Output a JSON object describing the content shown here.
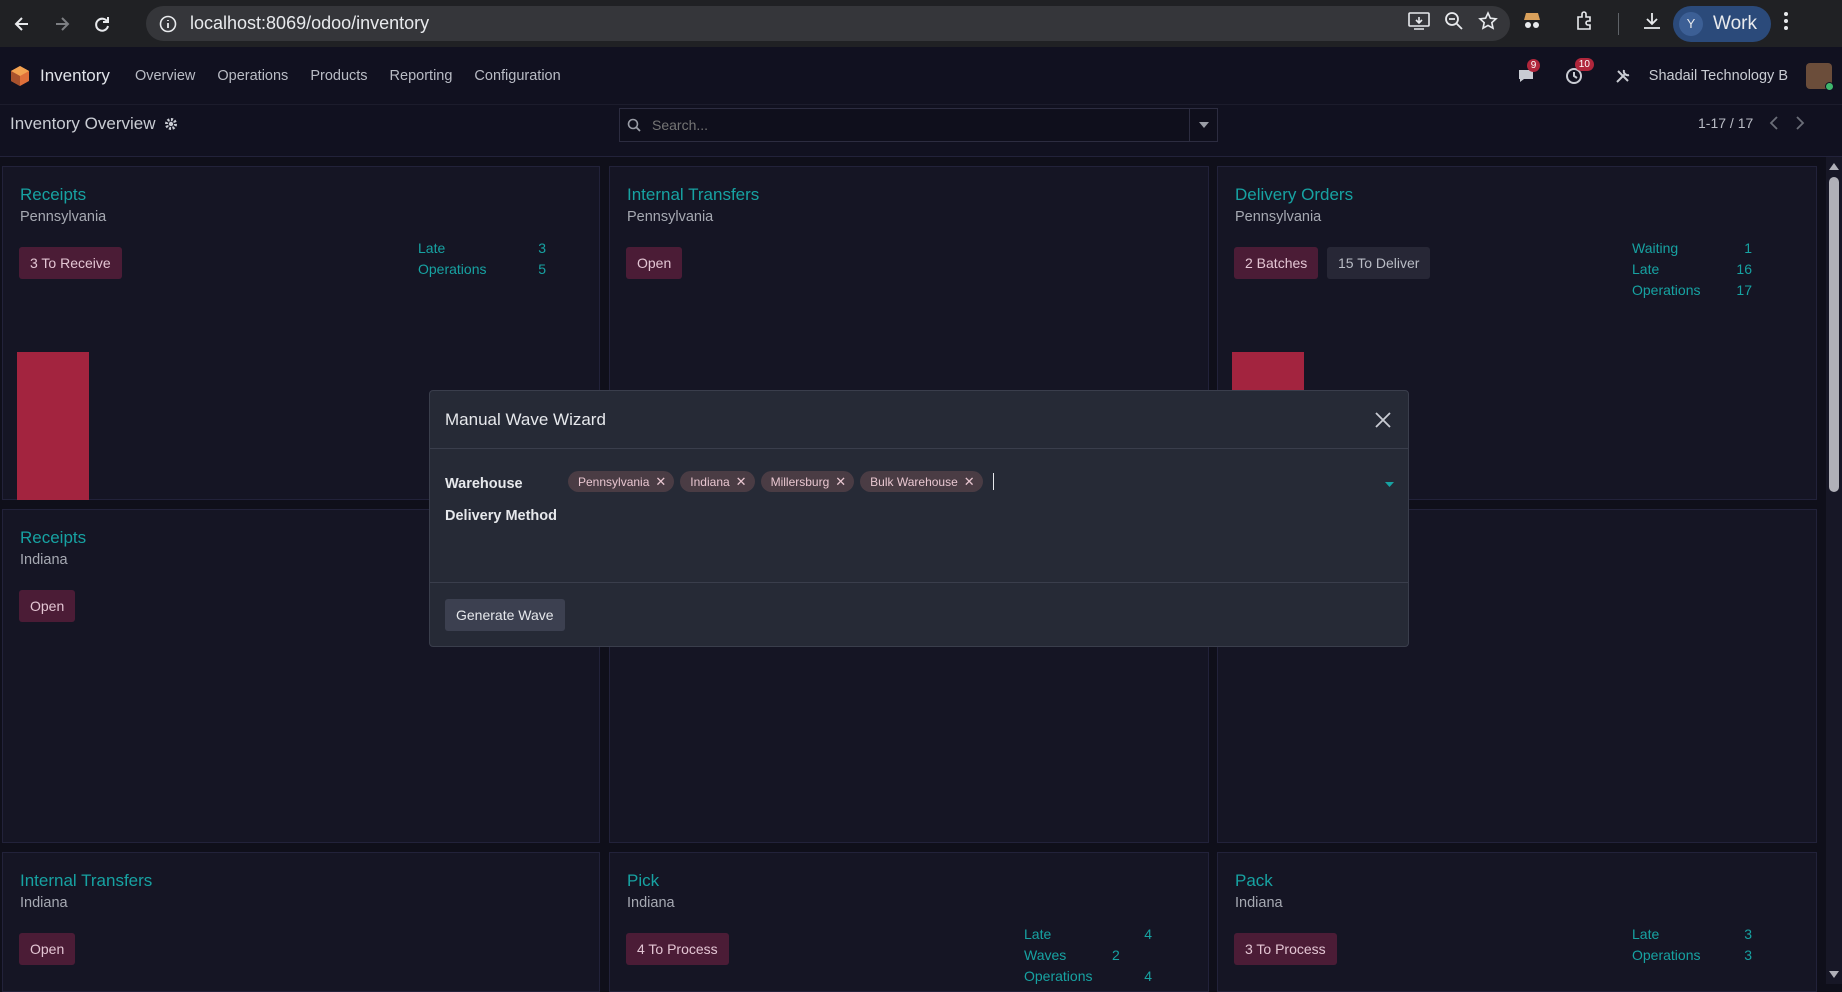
{
  "browser": {
    "url": "localhost:8069/odoo/inventory",
    "profile_initial": "Y",
    "profile_name": "Work"
  },
  "navbar": {
    "app_name": "Inventory",
    "menu": [
      "Overview",
      "Operations",
      "Products",
      "Reporting",
      "Configuration"
    ],
    "messages_count": "9",
    "activities_count": "10",
    "company": "Shadail Technology B"
  },
  "control_panel": {
    "title": "Inventory Overview",
    "search_placeholder": "Search...",
    "pager": "1-17 / 17"
  },
  "cards": {
    "c1": {
      "title": "Receipts",
      "sub": "Pennsylvania",
      "btn": "3 To Receive",
      "stats": [
        {
          "label": "Late",
          "value": "3"
        },
        {
          "label": "Operations",
          "value": "5"
        }
      ]
    },
    "c2": {
      "title": "Internal Transfers",
      "sub": "Pennsylvania",
      "btn": "Open"
    },
    "c3": {
      "title": "Delivery Orders",
      "sub": "Pennsylvania",
      "btn1": "2 Batches",
      "btn2": "15 To Deliver",
      "stats": [
        {
          "label": "Waiting",
          "value": "1"
        },
        {
          "label": "Late",
          "value": "16"
        },
        {
          "label": "Operations",
          "value": "17"
        }
      ]
    },
    "c4": {
      "title": "Receipts",
      "sub": "Indiana",
      "btn": "Open"
    },
    "c7": {
      "title": "Internal Transfers",
      "sub": "Indiana",
      "btn": "Open"
    },
    "c8": {
      "title": "Pick",
      "sub": "Indiana",
      "btn": "4 To Process",
      "stats": [
        {
          "label": "Late",
          "value": "4"
        },
        {
          "label": "Waves",
          "value": "2"
        },
        {
          "label": "Operations",
          "value": "4"
        }
      ]
    },
    "c9": {
      "title": "Pack",
      "sub": "Indiana",
      "btn": "3 To Process",
      "stats": [
        {
          "label": "Late",
          "value": "3"
        },
        {
          "label": "Operations",
          "value": "3"
        }
      ]
    }
  },
  "colors": {
    "accent": "#17a2a2",
    "primary_btn": "#4b1c36",
    "bar": "#a3243f"
  },
  "modal": {
    "title": "Manual Wave Wizard",
    "warehouse_label": "Warehouse",
    "warehouse_tags": [
      "Pennsylvania",
      "Indiana",
      "Millersburg",
      "Bulk Warehouse"
    ],
    "delivery_method_label": "Delivery Method",
    "generate_label": "Generate Wave"
  }
}
